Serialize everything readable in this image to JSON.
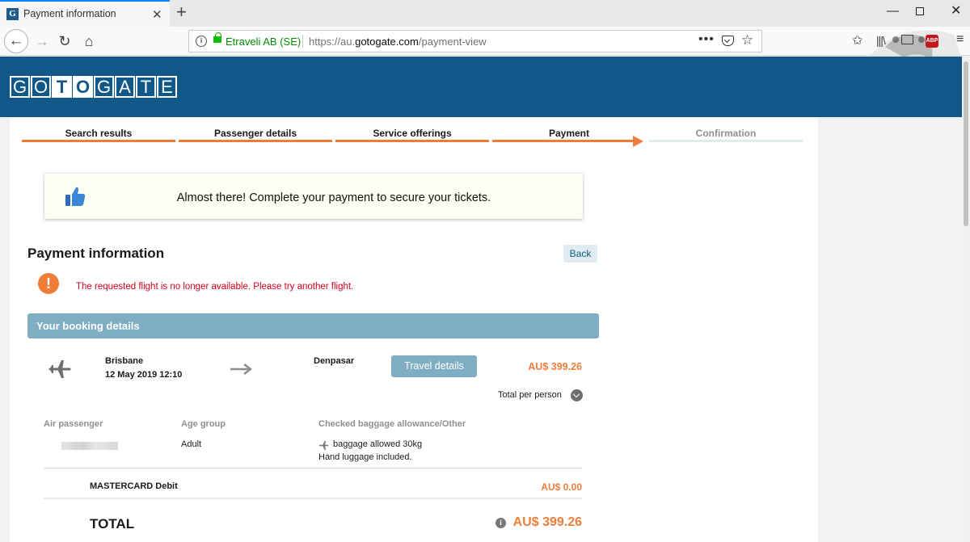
{
  "browser": {
    "tab_title": "Payment information",
    "tab_favicon": "G",
    "new_tab": "+",
    "org": "Etraveli AB (SE)",
    "url_prefix": "https://au.",
    "url_domain": "gotogate.com",
    "url_path": "/payment-view",
    "page_actions": "•••"
  },
  "site": {
    "logo_letters": [
      "G",
      "O",
      "T",
      "O",
      "G",
      "A",
      "T",
      "E"
    ],
    "logo_highlight": "T"
  },
  "steps": [
    {
      "label": "Search results",
      "state": "done"
    },
    {
      "label": "Passenger details",
      "state": "done"
    },
    {
      "label": "Service offerings",
      "state": "done"
    },
    {
      "label": "Payment",
      "state": "current"
    },
    {
      "label": "Confirmation",
      "state": "future"
    }
  ],
  "notice": {
    "icon": "thumbs-up-icon",
    "text": "Almost there! Complete your payment to secure your tickets."
  },
  "payment": {
    "title": "Payment information",
    "back_label": "Back",
    "error_icon": "!",
    "error_text": "The requested flight is no longer available. Please try another flight."
  },
  "booking": {
    "header": "Your booking details",
    "from_city": "Brisbane",
    "from_date": "12 May 2019 12:10",
    "to_city": "Denpasar",
    "travel_details_label": "Travel details",
    "price": "AU$ 399.26",
    "price_note": "Total per person",
    "columns": {
      "passenger": "Air passenger",
      "age": "Age group",
      "baggage": "Checked baggage allowance/Other"
    },
    "passenger": {
      "age_group": "Adult",
      "baggage": "baggage allowed 30kg",
      "hand_luggage": "Hand luggage included."
    },
    "card_label": "MASTERCARD Debit",
    "card_fee": "AU$ 0.00",
    "total_label": "TOTAL",
    "total_info": "i",
    "total_amount": "AU$ 399.26"
  },
  "colors": {
    "header_blue": "#0f5887",
    "accent_orange": "#ef7d3a",
    "booking_bar": "#7faec4",
    "error_red": "#d0021b"
  }
}
